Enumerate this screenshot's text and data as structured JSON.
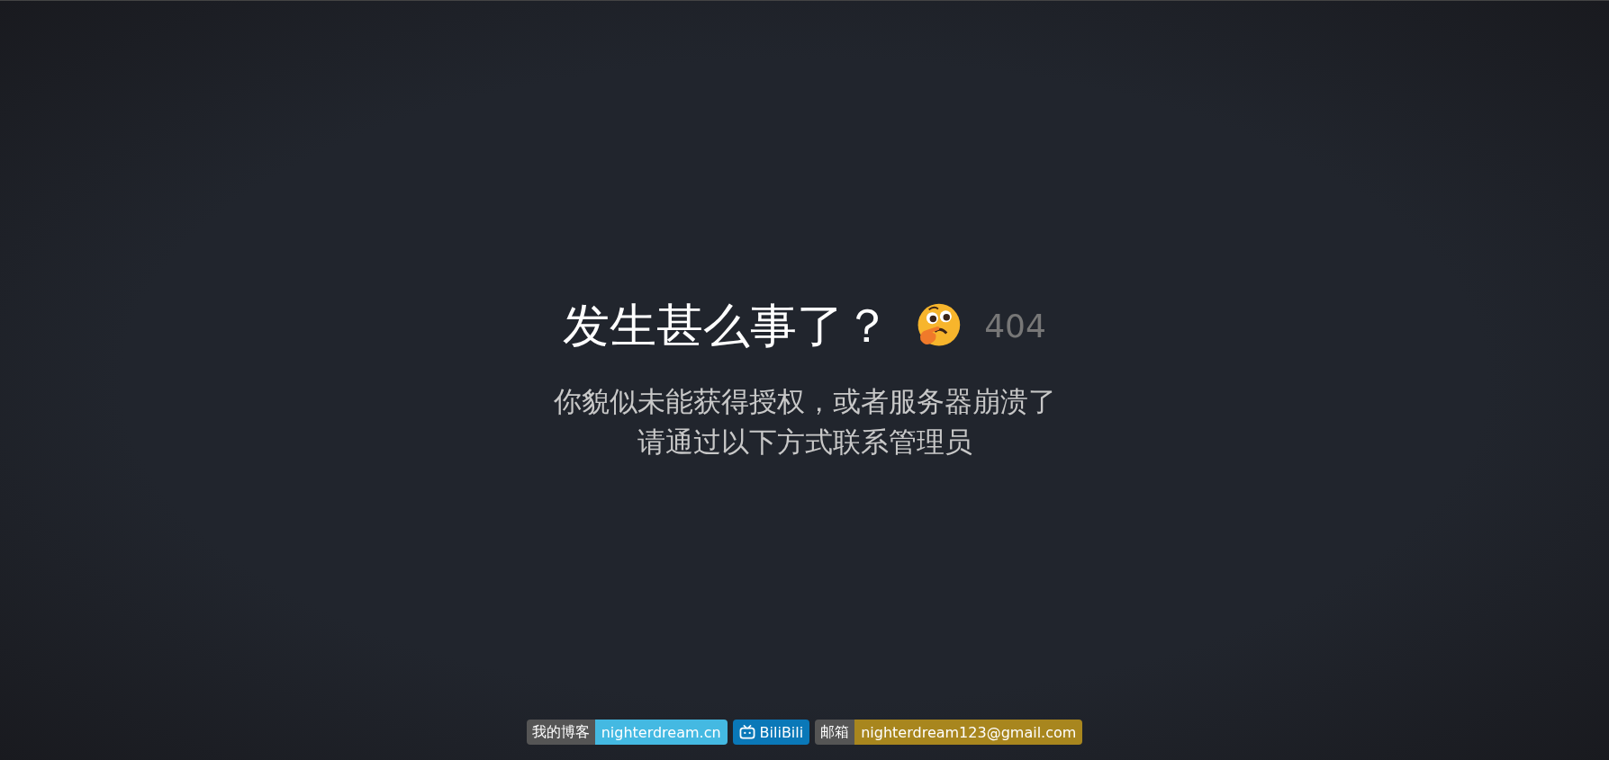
{
  "heading": {
    "title": "发生甚么事了？",
    "code": "404"
  },
  "message": [
    "你貌似未能获得授权，或者服务器崩溃了",
    "请通过以下方式联系管理员"
  ],
  "badges": [
    {
      "kind": "pair",
      "label": "我的博客",
      "value": "nighterdream.cn",
      "color": "#44b9e2"
    },
    {
      "kind": "icon",
      "value": "BiliBili",
      "color": "#0a78b8"
    },
    {
      "kind": "pair",
      "label": "邮箱",
      "value": "nighterdream123@gmail.com",
      "color": "#a8861e"
    }
  ]
}
